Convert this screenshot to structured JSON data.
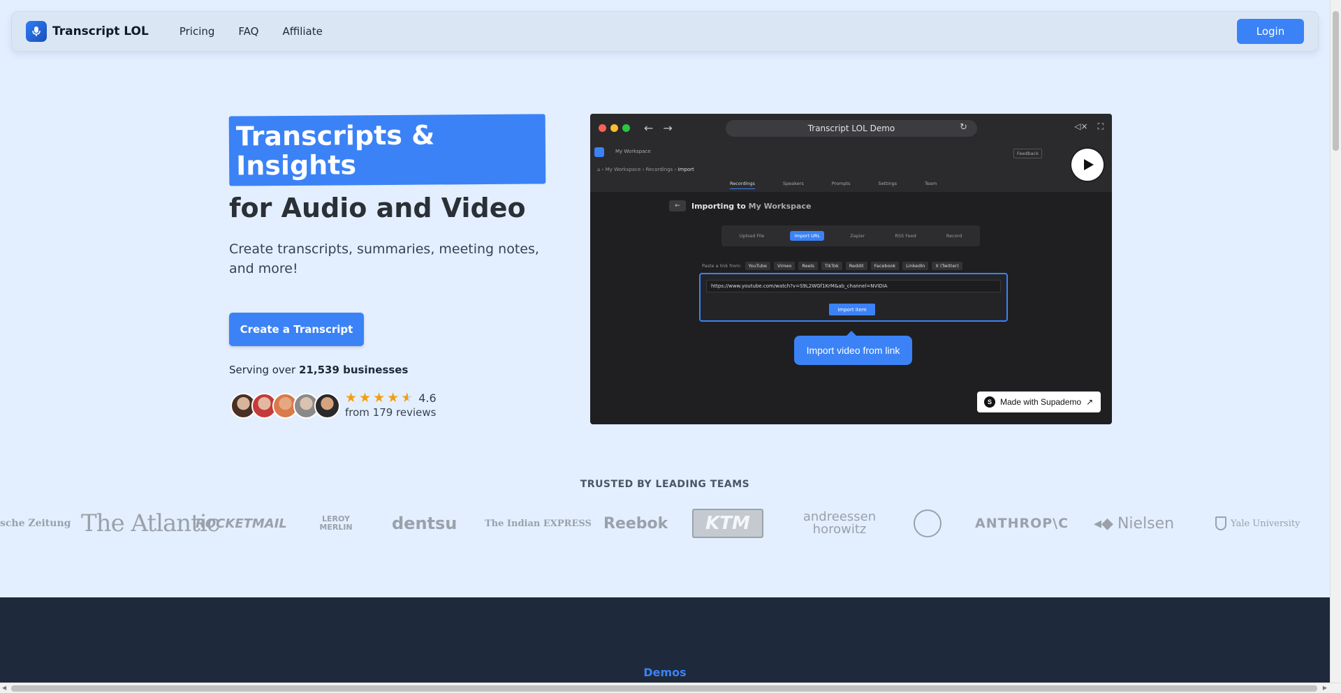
{
  "nav": {
    "logo_text": "Transcript LOL",
    "links": [
      "Pricing",
      "FAQ",
      "Affiliate"
    ],
    "login_label": "Login"
  },
  "hero": {
    "title_highlight": "Transcripts & Insights",
    "title_rest": "for Audio and Video",
    "description": "Create transcripts, summaries, meeting notes, and more!",
    "cta_label": "Create a Transcript",
    "serving_prefix": "Serving over",
    "serving_count": "21,539 businesses",
    "rating_value": "4.6",
    "rating_stars": 4.6,
    "reviews_text": "from 179 reviews"
  },
  "demo": {
    "url_title": "Transcript LOL Demo",
    "workspace": "My Workspace",
    "feedback": "Feedback",
    "breadcrumbs": [
      "My Workspace",
      "Recordings",
      "Import"
    ],
    "app_tabs": [
      "Recordings",
      "Speakers",
      "Prompts",
      "Settings",
      "Team"
    ],
    "import_title": "Importing to",
    "import_workspace": "My Workspace",
    "import_tabs": [
      "Upload File",
      "Import URL",
      "Zapier",
      "RSS Feed",
      "Record"
    ],
    "source_label": "Paste a link from:",
    "sources": [
      "YouTube",
      "Vimeo",
      "Reels",
      "TikTok",
      "Reddit",
      "Facebook",
      "LinkedIn",
      "X (Twitter)"
    ],
    "url_value": "https://www.youtube.com/watch?v=S9L2WGf1KrM&ab_channel=NVIDIA",
    "import_item_label": "Import item",
    "tooltip": "Import video from link",
    "supademo_label": "Made with Supademo"
  },
  "trusted": {
    "heading": "TRUSTED BY LEADING TEAMS",
    "brands": [
      "sche Zeitung",
      "The Atlantic",
      "ROCKETMAIL",
      "LEROY MERLIN",
      "dentsu",
      "The Indian EXPRESS",
      "Reebok",
      "KTM",
      "andreessen horowitz",
      "ANTHROP\\C",
      "Nielsen",
      "Yale University"
    ]
  },
  "demos_section": {
    "label": "Demos"
  },
  "colors": {
    "accent": "#3b82f6",
    "background": "#e3efff",
    "dark_section": "#1e293b",
    "star": "#f59e0b"
  }
}
